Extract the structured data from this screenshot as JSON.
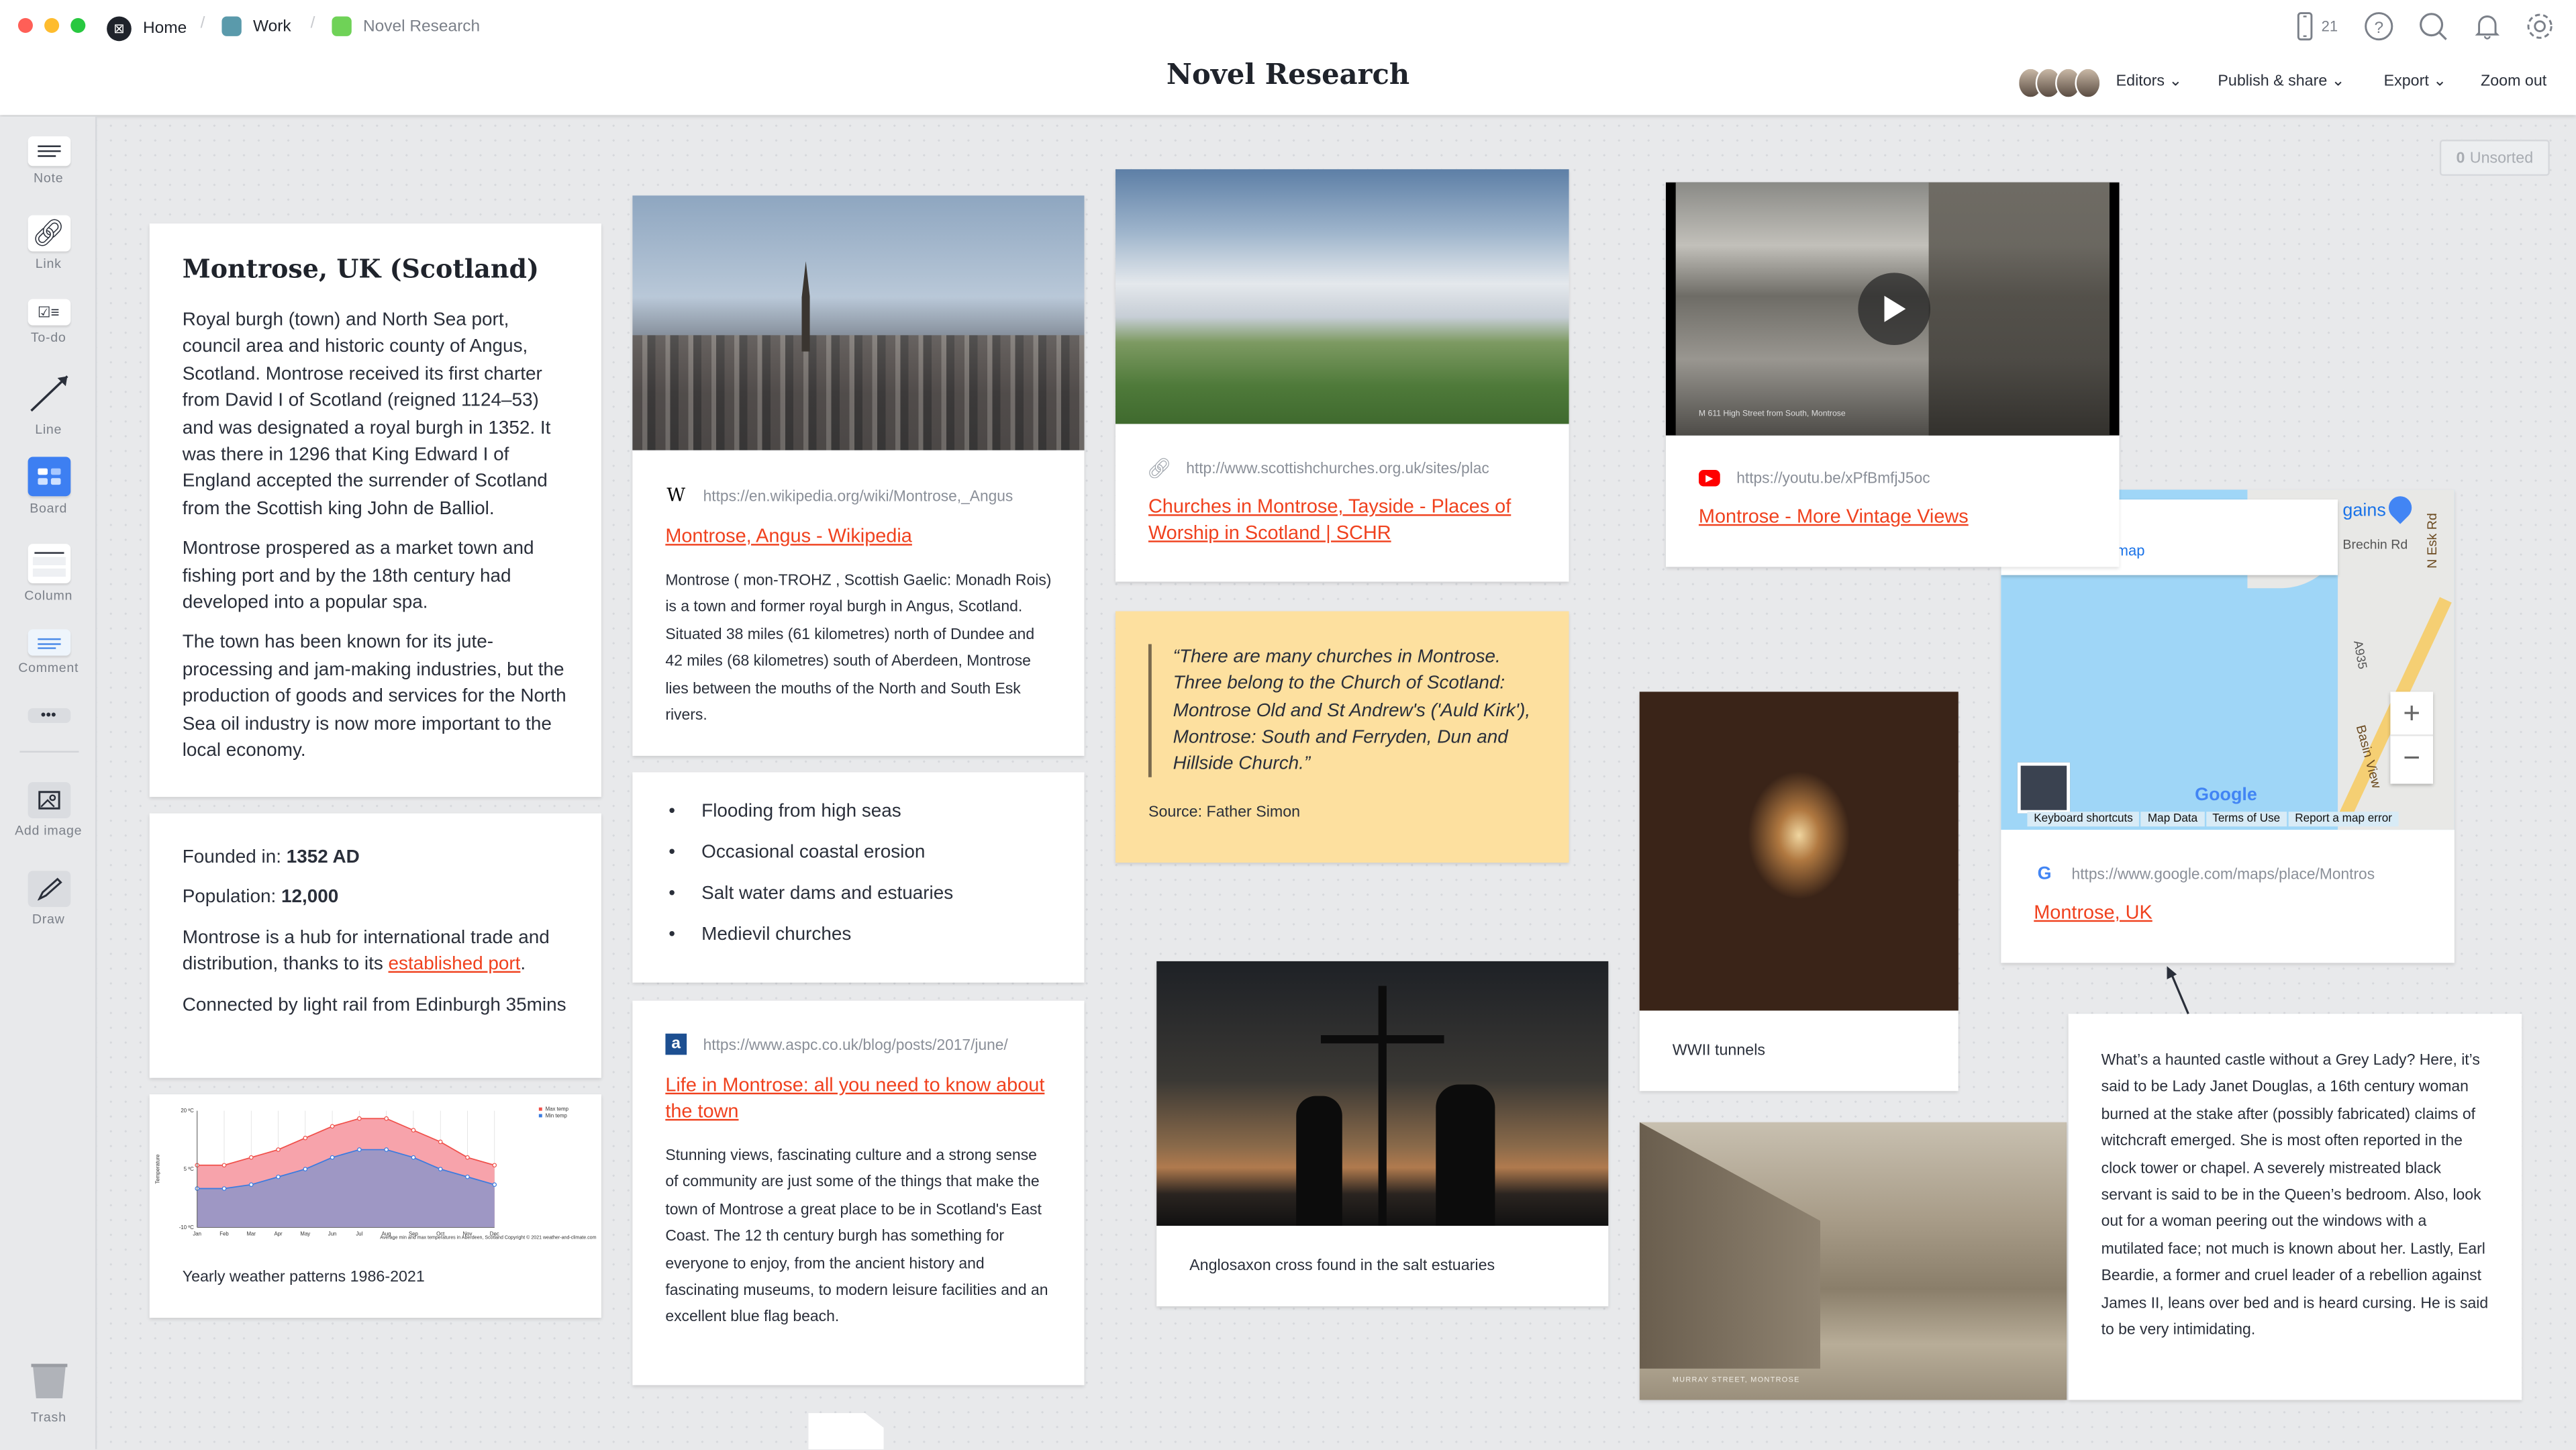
{
  "window": {
    "traffic_lights": [
      "#ff5f57",
      "#febc2e",
      "#28c840"
    ]
  },
  "breadcrumb": [
    {
      "label": "Home",
      "color": "#1f232b"
    },
    {
      "label": "Work",
      "color": "#5a9aab"
    },
    {
      "label": "Novel Research",
      "color": "#6fd257"
    }
  ],
  "board_title": "Novel Research",
  "top_icons": {
    "device_count": "21",
    "icons": [
      "mobile-icon",
      "help-icon",
      "search-icon",
      "bell-icon",
      "gear-icon"
    ]
  },
  "menu": {
    "editors": "Editors",
    "publish": "Publish & share",
    "export": "Export",
    "zoom": "Zoom out"
  },
  "unsorted": {
    "count": "0",
    "label": "Unsorted"
  },
  "sidebar": {
    "items": [
      {
        "label": "Note"
      },
      {
        "label": "Link"
      },
      {
        "label": "To-do"
      },
      {
        "label": "Line"
      },
      {
        "label": "Board"
      },
      {
        "label": "Column"
      },
      {
        "label": "Comment"
      },
      {
        "label": "Add image"
      },
      {
        "label": "Draw"
      },
      {
        "label": "Trash"
      }
    ],
    "board_color": "#3d7ff2"
  },
  "note_main": {
    "title": "Montrose, UK (Scotland)",
    "paragraphs": [
      "Royal burgh (town) and North Sea port, council area and historic county of Angus, Scotland. Montrose received its first charter from David I of Scotland (reigned 1124–53) and was designated a royal burgh in 1352. It was there in 1296 that King Edward I of England accepted the surrender of Scotland from the Scottish king John de Balliol.",
      "Montrose prospered as a market town and fishing port and by the 18th century had developed into a popular spa.",
      "The town has been known for its jute-processing and jam-making industries, but the production of goods and services for the North Sea oil industry is now more important to the local economy."
    ]
  },
  "facts": {
    "founded_label": "Founded in: ",
    "founded": "1352 AD",
    "population_label": "Population: ",
    "population": "12,000",
    "hub_text": "Montrose is a hub for international trade and distribution, thanks to its ",
    "hub_link": "established port",
    "hub_end": ".",
    "rail": "Connected by light rail from Edinburgh 35mins"
  },
  "weather_card": {
    "caption": "Yearly weather patterns 1986-2021"
  },
  "chart_data": {
    "type": "area",
    "categories": [
      "Jan",
      "Feb",
      "Mar",
      "Apr",
      "May",
      "Jun",
      "Jul",
      "Aug",
      "Sep",
      "Oct",
      "Nov",
      "Dec"
    ],
    "series": [
      {
        "name": "Max temp",
        "color": "#f0504a",
        "fill": "#f7a3ab",
        "values": [
          6,
          6,
          8,
          10,
          13,
          16,
          18,
          18,
          15,
          12,
          8,
          6
        ]
      },
      {
        "name": "Min temp",
        "color": "#3a7be0",
        "fill": "#9e97c4",
        "values": [
          0,
          0,
          1,
          3,
          5,
          8,
          10,
          10,
          8,
          5,
          3,
          1
        ]
      }
    ],
    "ylabel": "Temperature",
    "yticks": [
      "20 ºC",
      "5 ºC",
      "-10 ºC"
    ],
    "ylim": [
      -10,
      20
    ],
    "legend": "top-right",
    "grid": true,
    "footer": "Average min and max temperatures in Aberdeen, Scotland   Copyright © 2021  weather-and-climate.com"
  },
  "wiki": {
    "url": "https://en.wikipedia.org/wiki/Montrose,_Angus",
    "title": "Montrose, Angus - Wikipedia",
    "text": "Montrose ( mon-TROHZ , Scottish Gaelic: Monadh Rois) is a town and former royal burgh in Angus, Scotland. Situated 38 miles (61 kilometres) north of Dundee and 42 miles (68 kilometres) south of Aberdeen, Montrose lies between the mouths of the North and South Esk rivers.",
    "favicon": "W"
  },
  "bullets": [
    "Flooding from high seas",
    "Occasional coastal erosion",
    "Salt water dams and estuaries",
    "Medievil churches"
  ],
  "aspc": {
    "url": "https://www.aspc.co.uk/blog/posts/2017/june/",
    "title": "Life in Montrose: all you need to know about the town",
    "text": "Stunning views, fascinating culture and a strong sense of community are just some of the things that make the town of Montrose a great place to be in Scotland's East Coast. The 12 th century burgh has something for everyone to enjoy, from the ancient history and fascinating museums, to modern leisure facilities and an excellent blue flag beach.",
    "favicon": "a"
  },
  "churches": {
    "url": "http://www.scottishchurches.org.uk/sites/plac",
    "title": "Churches in Montrose, Tayside - Places of Worship in Scotland | SCHR"
  },
  "quote": {
    "text": "“There are many churches in Montrose. Three belong to the Church of Scotland: Montrose Old and St Andrew's ('Auld Kirk'), Montrose: South and Ferryden, Dun and Hillside Church.”",
    "source": "Source: Father Simon",
    "bg": "#fde09f"
  },
  "cross": {
    "caption": "Anglosaxon cross found in the salt estuaries"
  },
  "youtube": {
    "url": "https://youtu.be/xPfBmfjJ5oc",
    "title": "Montrose - More Vintage Views",
    "video_caption": "M 611   High Street from South, Montrose"
  },
  "tunnels": {
    "caption": "WWII tunnels"
  },
  "map": {
    "url": "https://www.google.com/maps/place/Montros",
    "title": "Montrose, UK",
    "labels": {
      "gains": "gains",
      "brechin": "Brechin Rd",
      "nesk": "N Esk Rd",
      "a935": "A935",
      "basin": "Basin View",
      "view_link": "map",
      "google": "Google"
    },
    "footer": [
      "Keyboard shortcuts",
      "Map Data",
      "Terms of Use",
      "Report a map error"
    ],
    "zoom_in": "+",
    "zoom_out": "−"
  },
  "street": {
    "caption": "MURRAY STREET, MONTROSE"
  },
  "ghost": {
    "text": "What’s a haunted castle without a Grey Lady? Here, it’s said to be Lady Janet Douglas, a 16th century woman burned at the stake after (possibly fabricated) claims of witchcraft emerged. She is most often reported in the clock tower or chapel. A severely mistreated black servant is said to be in the Queen’s bedroom. Also, look out for a woman peering out the windows with a mutilated face; not much is known about her. Lastly, Earl Beardie, a former and cruel leader of a rebellion against James II, leans over bed and is heard cursing. He is said to be very intimidating."
  },
  "accent": "#f0411e"
}
